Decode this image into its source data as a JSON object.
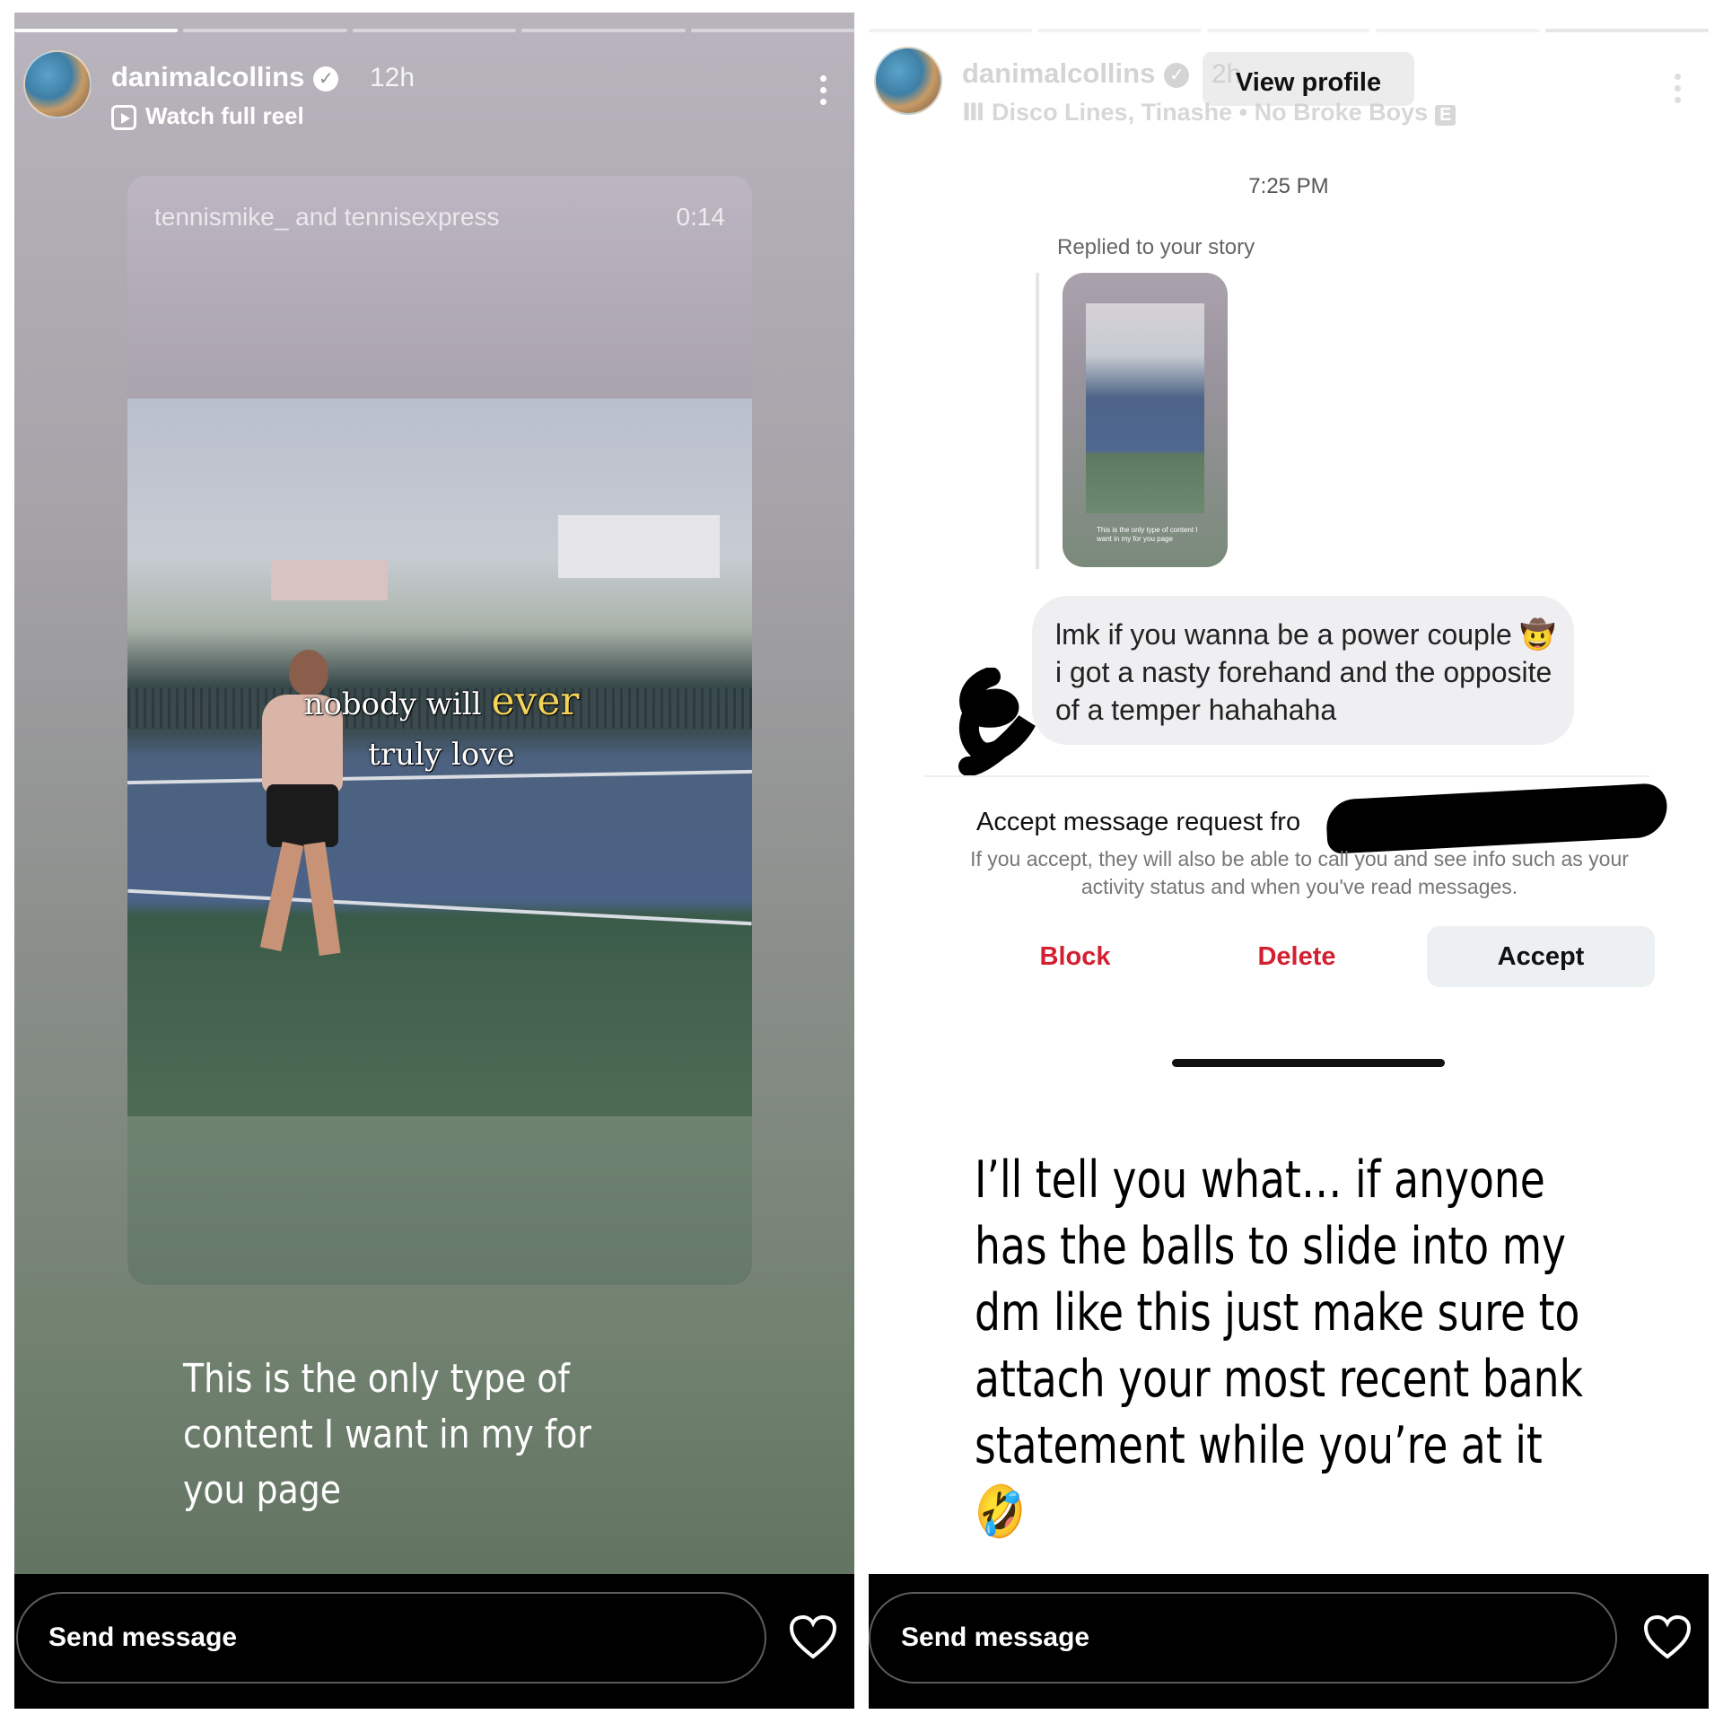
{
  "left_story": {
    "username": "danimalcollins",
    "time_ago": "12h",
    "subtitle": "Watch full reel",
    "reel": {
      "credit": "tennismike_ and tennisexpress",
      "duration": "0:14",
      "overlay_line1_plain": "nobody will",
      "overlay_line1_emphasis": "ever",
      "overlay_line2": "truly love"
    },
    "caption": "This is the only type of content I want in my for you page",
    "footer": {
      "send_placeholder": "Send message"
    }
  },
  "right_story": {
    "username": "danimalcollins",
    "time_ago": "2h",
    "music": "Disco Lines, Tinashe • No Broke Boys",
    "music_explicit": "E",
    "view_profile": "View profile",
    "chat": {
      "time": "7:25 PM",
      "replied_label": "Replied to your story",
      "thumb_caption": "This is the only type of content I want in my for you page",
      "message": "lmk if you wanna be a power couple 🤠 i got a nasty forehand and the opposite of a temper hahahaha",
      "accept_title": "Accept message request fro",
      "accept_note": "If you accept, they will also be able to call you and see info such as your activity status and when you've read messages.",
      "actions": {
        "block": "Block",
        "delete": "Delete",
        "accept": "Accept"
      }
    },
    "caption": "I’ll tell you what… if anyone has the balls to slide into my dm like this just make sure to attach your most recent bank  statement while you’re at it 🤣",
    "footer": {
      "send_placeholder": "Send message"
    }
  },
  "colors": {
    "destructive_action": "#d32030",
    "overlay_emphasis": "#f3d45a",
    "footer_bg": "#000000"
  },
  "icons": [
    "verified-badge-icon",
    "reel-icon",
    "more-options-icon",
    "heart-icon",
    "music-bars-icon"
  ]
}
